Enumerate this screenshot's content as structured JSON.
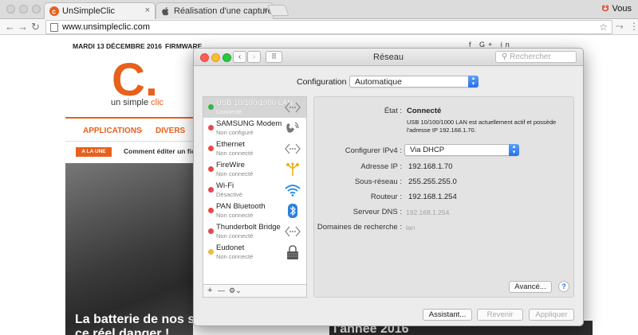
{
  "browser": {
    "tabs": [
      {
        "title": "UnSimpleClic"
      },
      {
        "title": "Réalisation d'une capture d'éc"
      }
    ],
    "profile": "Vous",
    "url": "www.unsimpleclic.com"
  },
  "site": {
    "date": "MARDI 13 DÉCEMBRE 2016",
    "top_nav_first": "FIRMWARE",
    "logo_mark": "C.",
    "logo_un_simple": "un simple",
    "logo_clic": "clic",
    "menu": [
      "APPLICATIONS",
      "DIVERS"
    ],
    "badge": "A LA UNE",
    "ticker": "Comment éditer un fich",
    "headline_line1": "La batterie de nos sm",
    "headline_line2": "ce réel danger !",
    "headline2": "l'année 2016"
  },
  "network": {
    "window_title": "Réseau",
    "search_placeholder": "Rechercher",
    "configuration_label": "Configuration :",
    "configuration_value": "Automatique",
    "services": [
      {
        "name": "USB 10/100/1000 LAN",
        "status": "Connecté",
        "dot": "#35b44a"
      },
      {
        "name": "SAMSUNG Modem",
        "status": "Non configuré",
        "dot": "#e8484a"
      },
      {
        "name": "Ethernet",
        "status": "Non connecté",
        "dot": "#e8484a"
      },
      {
        "name": "FireWire",
        "status": "Non connecté",
        "dot": "#e8484a"
      },
      {
        "name": "Wi-Fi",
        "status": "Désactivé",
        "dot": "#e8484a"
      },
      {
        "name": "PAN Bluetooth",
        "status": "Non connecté",
        "dot": "#e8484a"
      },
      {
        "name": "Thunderbolt Bridge",
        "status": "Non connecté",
        "dot": "#e8484a"
      },
      {
        "name": "Eudonet",
        "status": "Non connecté",
        "dot": "#f1b940"
      }
    ],
    "footer_add": "+",
    "footer_remove": "—",
    "footer_gear": "⚙︎⌄",
    "detail": {
      "etat_label": "État :",
      "etat_value": "Connecté",
      "etat_desc_1": "USB 10/100/1000 LAN est actuellement actif et possède",
      "etat_desc_2": "l'adresse IP 192.168.1.70.",
      "ipv4_label": "Configurer IPv4 :",
      "ipv4_value": "Via DHCP",
      "ip_label": "Adresse IP :",
      "ip_value": "192.168.1.70",
      "subnet_label": "Sous-réseau :",
      "subnet_value": "255.255.255.0",
      "router_label": "Routeur :",
      "router_value": "192.168.1.254",
      "dns_label": "Serveur DNS :",
      "dns_value": "192.168.1.254",
      "search_domains_label": "Domaines de recherche :",
      "search_domains_value": "lan",
      "advanced_button": "Avancé...",
      "help": "?"
    },
    "buttons": {
      "assistant": "Assistant...",
      "revert": "Revenir",
      "apply": "Appliquer"
    }
  }
}
